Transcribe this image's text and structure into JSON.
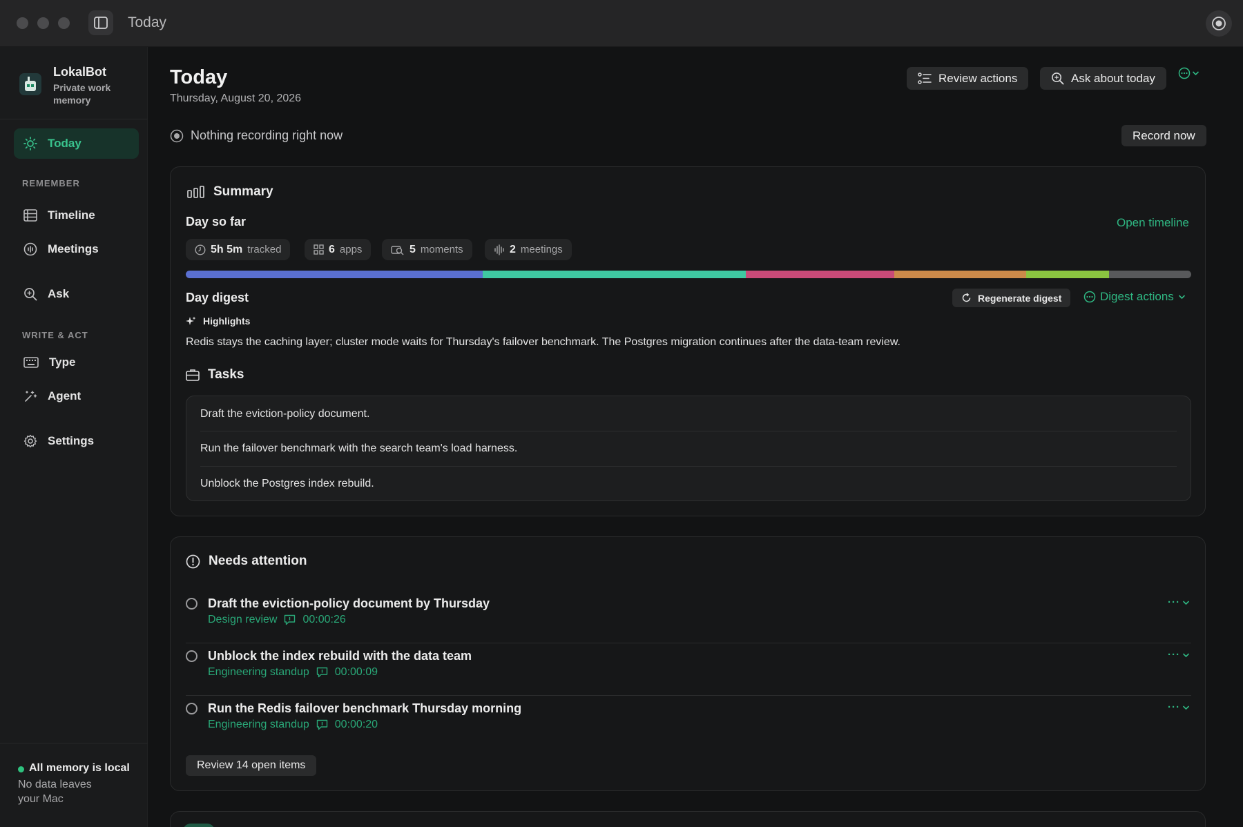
{
  "window": {
    "title": "Today"
  },
  "brand": {
    "name": "LokalBot",
    "tagline": "Private work memory"
  },
  "sidebar": {
    "primary": {
      "label": "Today",
      "icon": "sun-icon"
    },
    "sections": [
      {
        "label": "REMEMBER",
        "items": [
          {
            "label": "Timeline",
            "icon": "timeline-icon"
          },
          {
            "label": "Meetings",
            "icon": "meetings-icon"
          },
          {
            "label": "Ask",
            "icon": "search-icon"
          }
        ]
      },
      {
        "label": "WRITE & ACT",
        "items": [
          {
            "label": "Type",
            "icon": "keyboard-icon"
          },
          {
            "label": "Agent",
            "icon": "agent-icon"
          },
          {
            "label": "Settings",
            "icon": "gear-icon"
          }
        ]
      }
    ],
    "footer": {
      "title": "All memory is local",
      "subtitle": "No data leaves your Mac"
    }
  },
  "header": {
    "title": "Today",
    "date": "Thursday, August 20, 2026",
    "review_actions": "Review actions",
    "ask_about_today": "Ask about today"
  },
  "recording": {
    "status": "Nothing recording right now",
    "button": "Record now"
  },
  "summary": {
    "title": "Summary",
    "day_so_far": "Day so far",
    "open_timeline": "Open timeline",
    "chips": [
      {
        "value": "5h 5m",
        "label": "tracked",
        "icon": "clock-icon"
      },
      {
        "value": "6",
        "label": "apps",
        "icon": "apps-grid-icon"
      },
      {
        "value": "5",
        "label": "moments",
        "icon": "moments-icon"
      },
      {
        "value": "2",
        "label": "meetings",
        "icon": "waveform-icon"
      }
    ],
    "activity_segments": [
      {
        "fraction": 0.295,
        "color": "#5a6fd0"
      },
      {
        "fraction": 0.262,
        "color": "#3fc8a1"
      },
      {
        "fraction": 0.148,
        "color": "#c94a78"
      },
      {
        "fraction": 0.131,
        "color": "#cc8a4a"
      },
      {
        "fraction": 0.082,
        "color": "#8ac440"
      },
      {
        "fraction": 0.082,
        "color": "#58595b"
      }
    ],
    "digest": {
      "title": "Day digest",
      "regenerate": "Regenerate digest",
      "actions": "Digest actions",
      "highlights_label": "Highlights",
      "highlight_text": "Redis stays the caching layer; cluster mode waits for Thursday's failover benchmark. The Postgres migration continues after the data-team review."
    },
    "tasks": {
      "title": "Tasks",
      "items": [
        "Draft the eviction-policy document.",
        "Run the failover benchmark with the search team's load harness.",
        "Unblock the Postgres index rebuild."
      ]
    }
  },
  "attention": {
    "title": "Needs attention",
    "items": [
      {
        "title": "Draft the eviction-policy document by Thursday",
        "source": "Design review",
        "timestamp": "00:00:26"
      },
      {
        "title": "Unblock the index rebuild with the data team",
        "source": "Engineering standup",
        "timestamp": "00:00:09"
      },
      {
        "title": "Run the Redis failover benchmark Thursday morning",
        "source": "Engineering standup",
        "timestamp": "00:00:20"
      }
    ],
    "more_glyph": "···",
    "review_button": "Review 14 open items"
  },
  "colors": {
    "accent": "#2fb883",
    "background": "#121314",
    "card": "#161718"
  }
}
